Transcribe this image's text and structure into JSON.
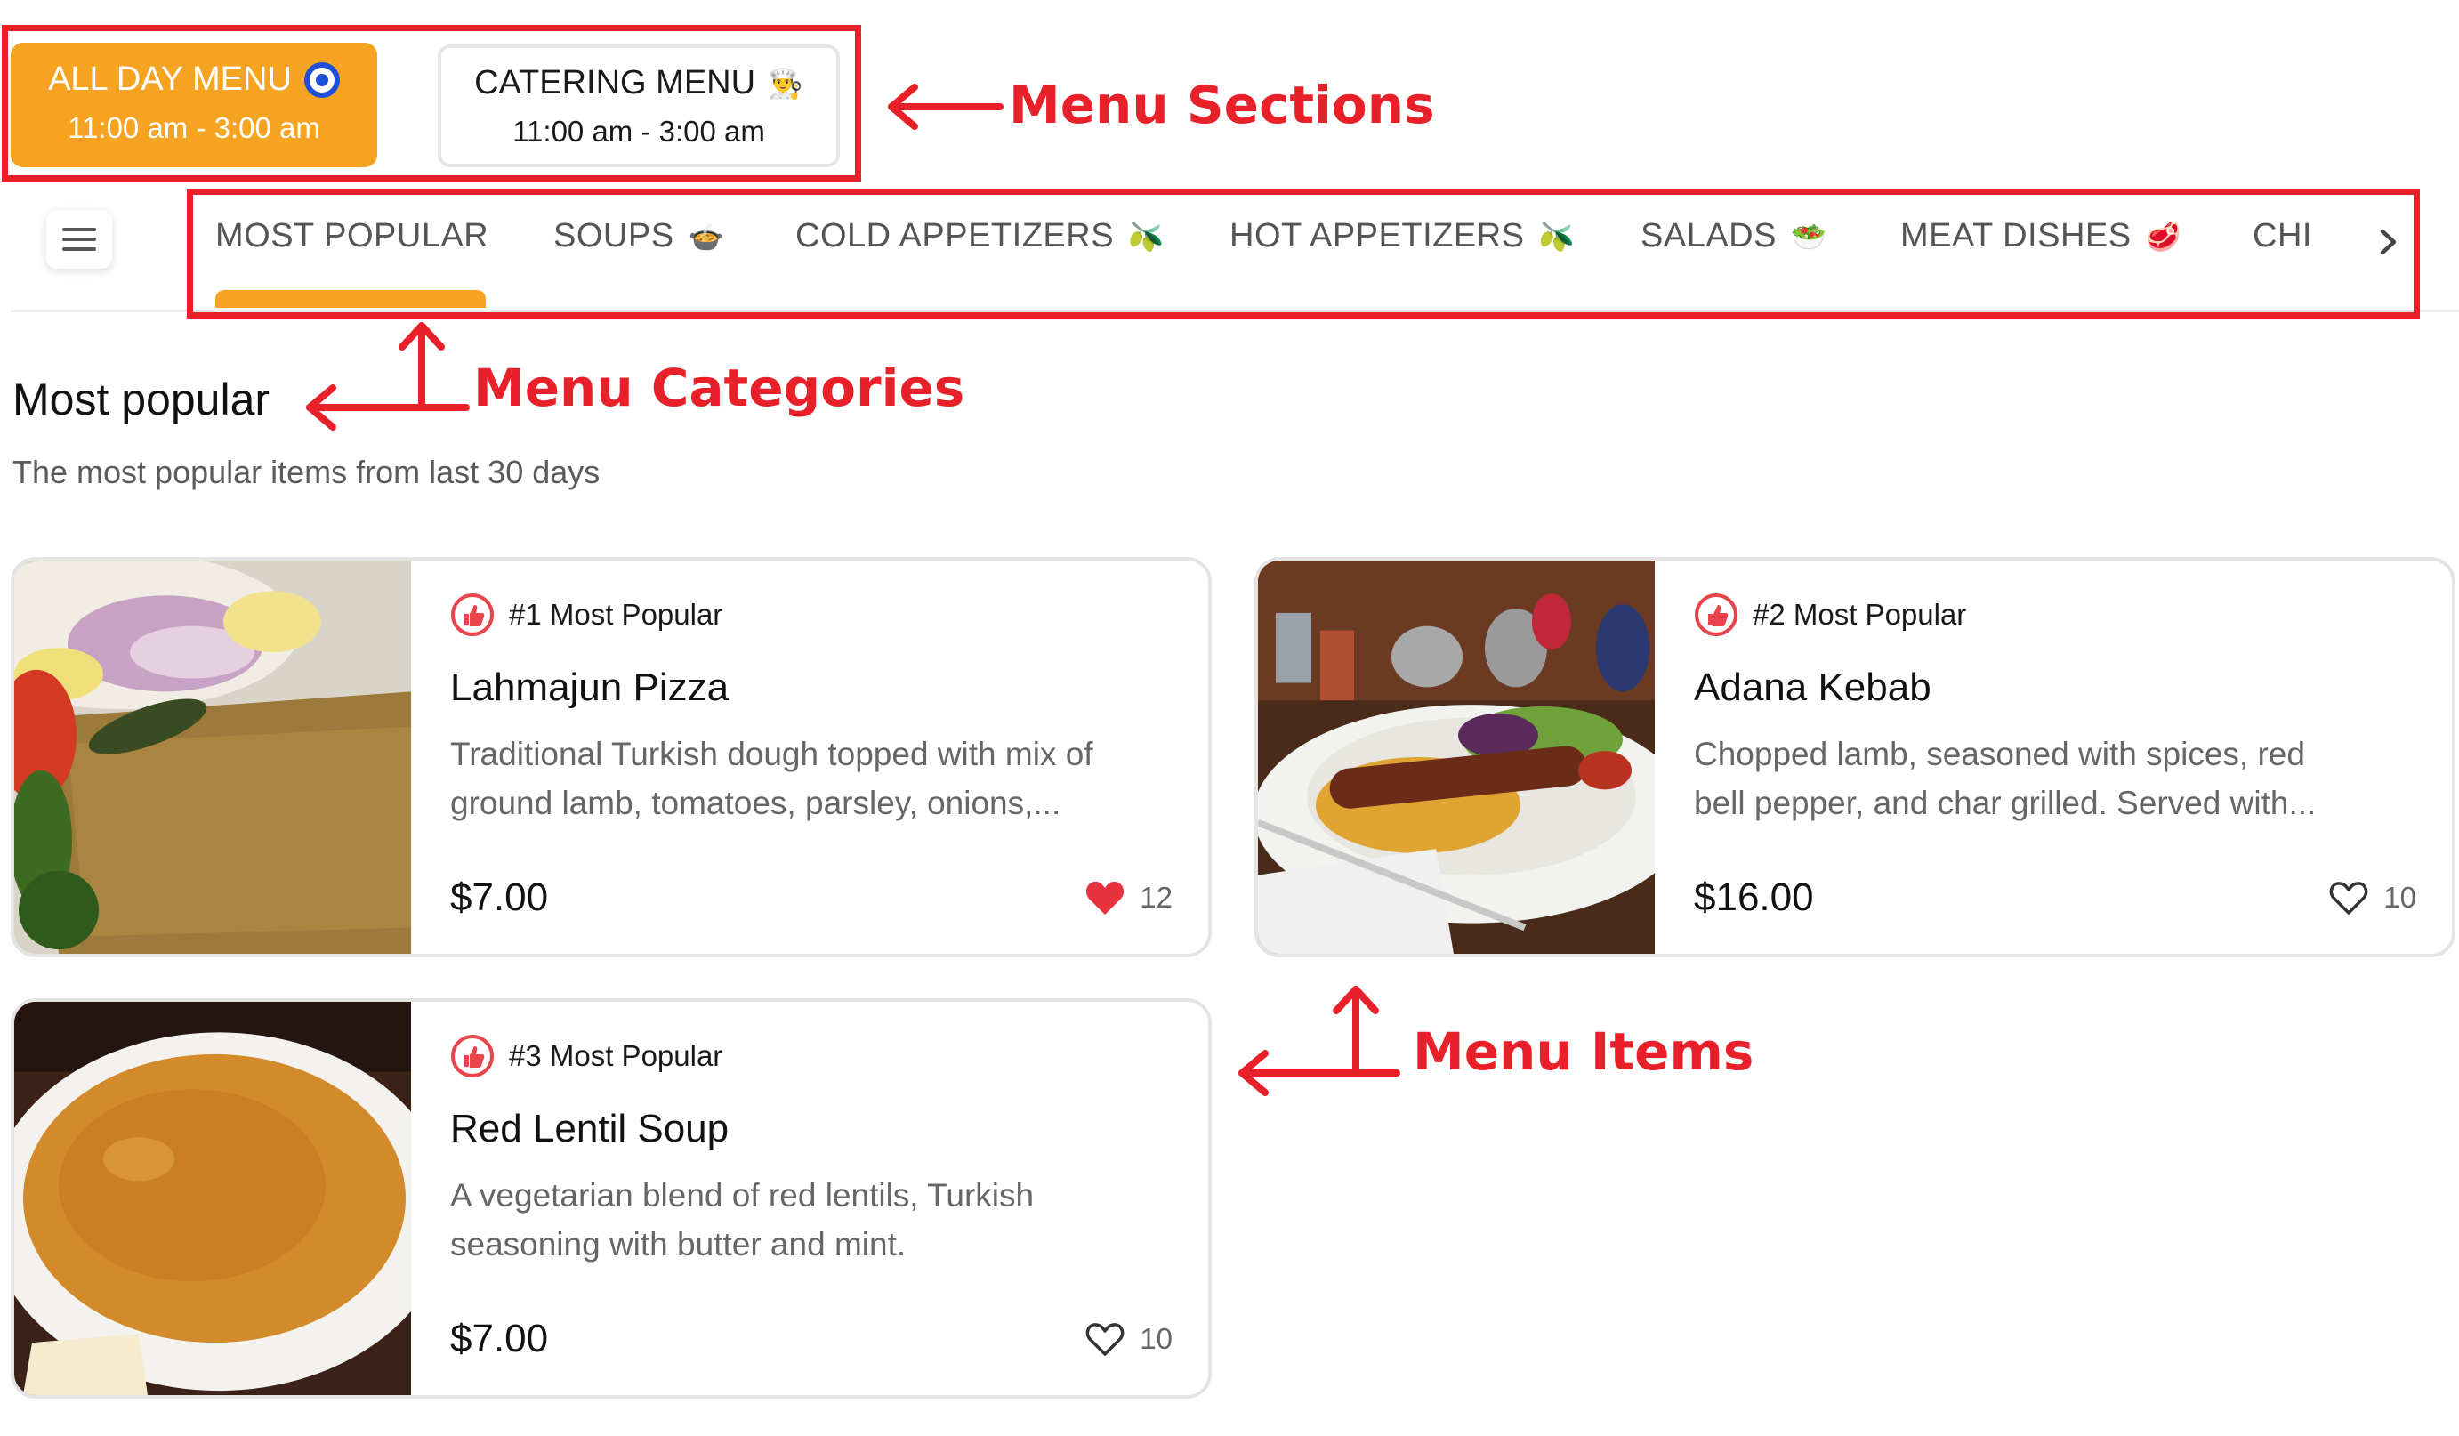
{
  "sections": [
    {
      "title": "ALL DAY MENU",
      "hours": "11:00 am - 3:00 am",
      "icon": "nazar-eye-icon",
      "active": true
    },
    {
      "title": "CATERING MENU",
      "hours": "11:00 am - 3:00 am",
      "icon": "chef-icon",
      "active": false
    }
  ],
  "categories": [
    {
      "label": "MOST POPULAR",
      "icon": "",
      "active": true
    },
    {
      "label": "SOUPS",
      "icon": "🍲"
    },
    {
      "label": "COLD APPETIZERS",
      "icon": "🫒"
    },
    {
      "label": "HOT APPETIZERS",
      "icon": "🫒"
    },
    {
      "label": "SALADS",
      "icon": "🥗"
    },
    {
      "label": "MEAT DISHES",
      "icon": "🥩"
    },
    {
      "label": "CHI",
      "icon": ""
    }
  ],
  "heading": {
    "title": "Most popular",
    "subtitle": "The most popular items from last 30 days"
  },
  "items": [
    {
      "rank": "#1 Most Popular",
      "name": "Lahmajun Pizza",
      "desc1": "Traditional Turkish dough topped with mix of",
      "desc2": "ground lamb, tomatoes, parsley, onions,...",
      "price": "$7.00",
      "likes": "12",
      "liked": true
    },
    {
      "rank": "#2 Most Popular",
      "name": "Adana Kebab",
      "desc1": "Chopped lamb, seasoned with spices, red",
      "desc2": "bell pepper, and char grilled. Served with...",
      "price": "$16.00",
      "likes": "10",
      "liked": false
    },
    {
      "rank": "#3 Most Popular",
      "name": "Red Lentil Soup",
      "desc1": "A vegetarian blend of red lentils, Turkish",
      "desc2": "seasoning with butter and mint.",
      "price": "$7.00",
      "likes": "10",
      "liked": false
    }
  ],
  "annotations": {
    "sections": "Menu Sections",
    "categories": "Menu Categories",
    "items": "Menu Items"
  },
  "colors": {
    "accent": "#f5a320",
    "annotation": "#e8202a",
    "heart_filled": "#e8333f",
    "badge": "#e8444a"
  }
}
